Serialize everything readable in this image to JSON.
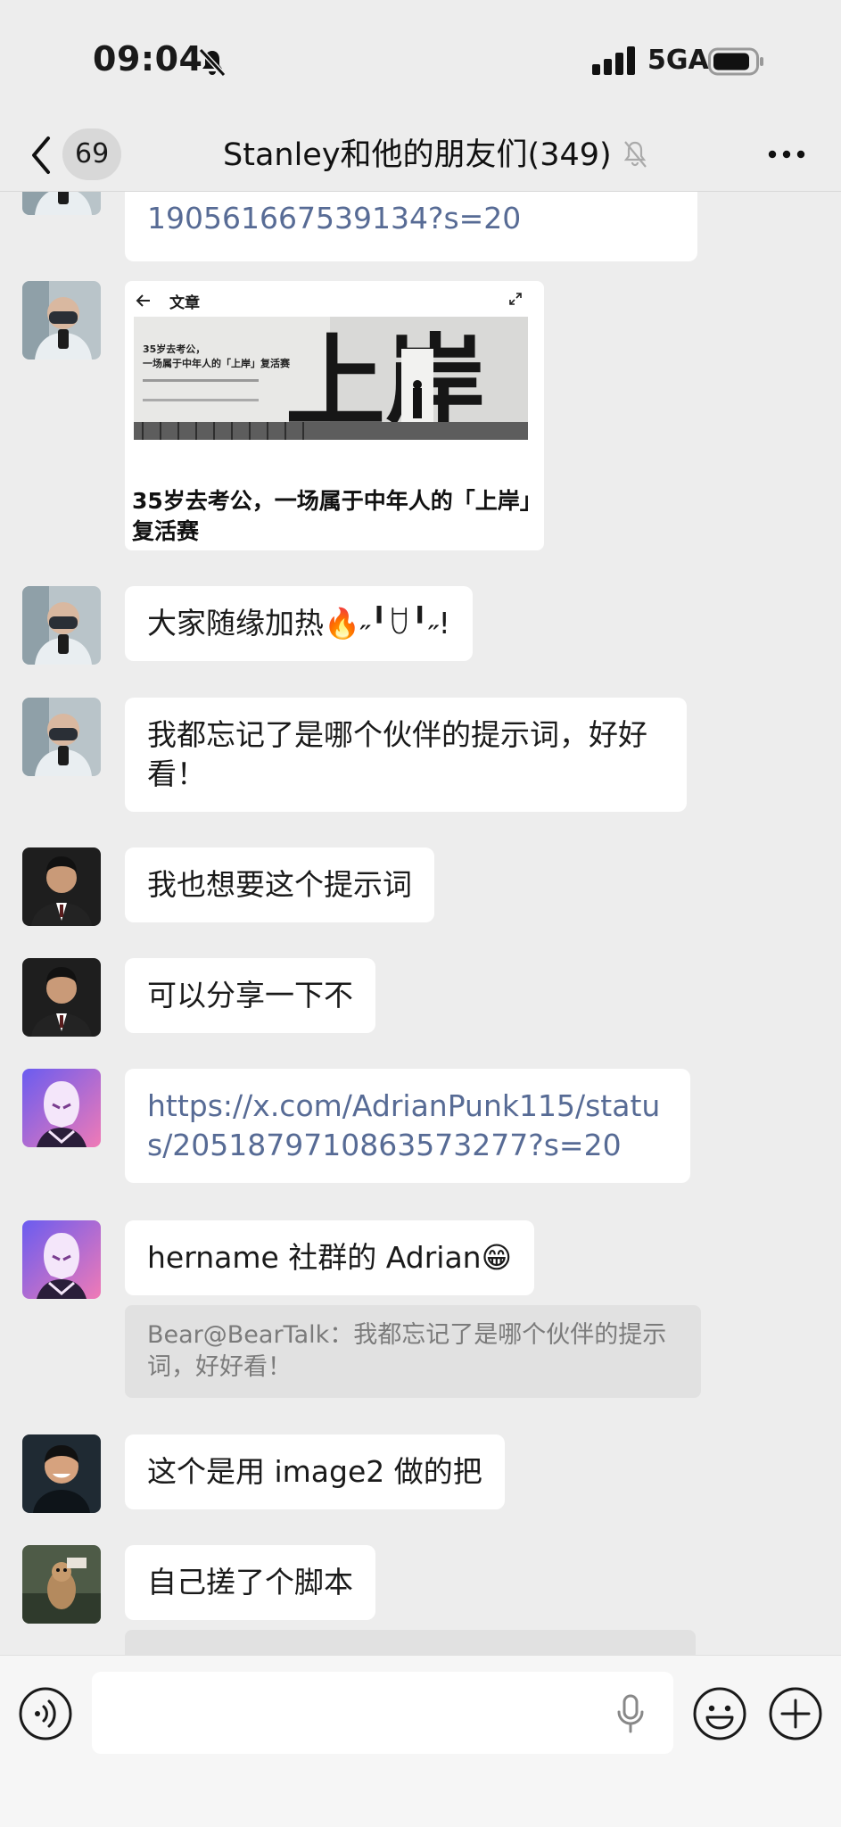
{
  "status_bar": {
    "time": "09:04",
    "network": "5GA"
  },
  "nav": {
    "unread_count": "69",
    "title": "Stanley和他的朋友们(349)"
  },
  "messages": [
    {
      "type": "link",
      "text": "190561667539134?s=20"
    },
    {
      "type": "article",
      "card_label": "文章",
      "hero_small_lines": [
        "35岁去考公，",
        "一场属于中年人的「上岸」复活赛"
      ],
      "hero_big_text": "上岸",
      "title": "35岁去考公，一场属于中年人的「上岸」复活赛"
    },
    {
      "type": "text",
      "text": "大家随缘加热🔥˶╹ꇴ╹˶!"
    },
    {
      "type": "text",
      "text": "我都忘记了是哪个伙伴的提示词，好好看！"
    },
    {
      "type": "text",
      "text": "我也想要这个提示词"
    },
    {
      "type": "text",
      "text": "可以分享一下不"
    },
    {
      "type": "link",
      "text": "https://x.com/AdrianPunk115/status/2051879710863573277?s=20"
    },
    {
      "type": "text",
      "text": "hername 社群的 Adrian😁",
      "quote": "Bear@BearTalk：我都忘记了是哪个伙伴的提示词，好好看！"
    },
    {
      "type": "text",
      "text": "这个是用 image2 做的把"
    },
    {
      "type": "text",
      "text": "自己搓了个脚本"
    }
  ],
  "input": {
    "placeholder": ""
  },
  "colors": {
    "background": "#EDEDED",
    "bubble": "#FFFFFF",
    "link": "#576B95",
    "quote_bg": "#E1E1E1",
    "quote_text": "#7B7B7B"
  },
  "icons": [
    "back-icon",
    "mute-icon",
    "more-icon",
    "voice-icon",
    "mic-icon",
    "emoji-icon",
    "plus-icon"
  ]
}
